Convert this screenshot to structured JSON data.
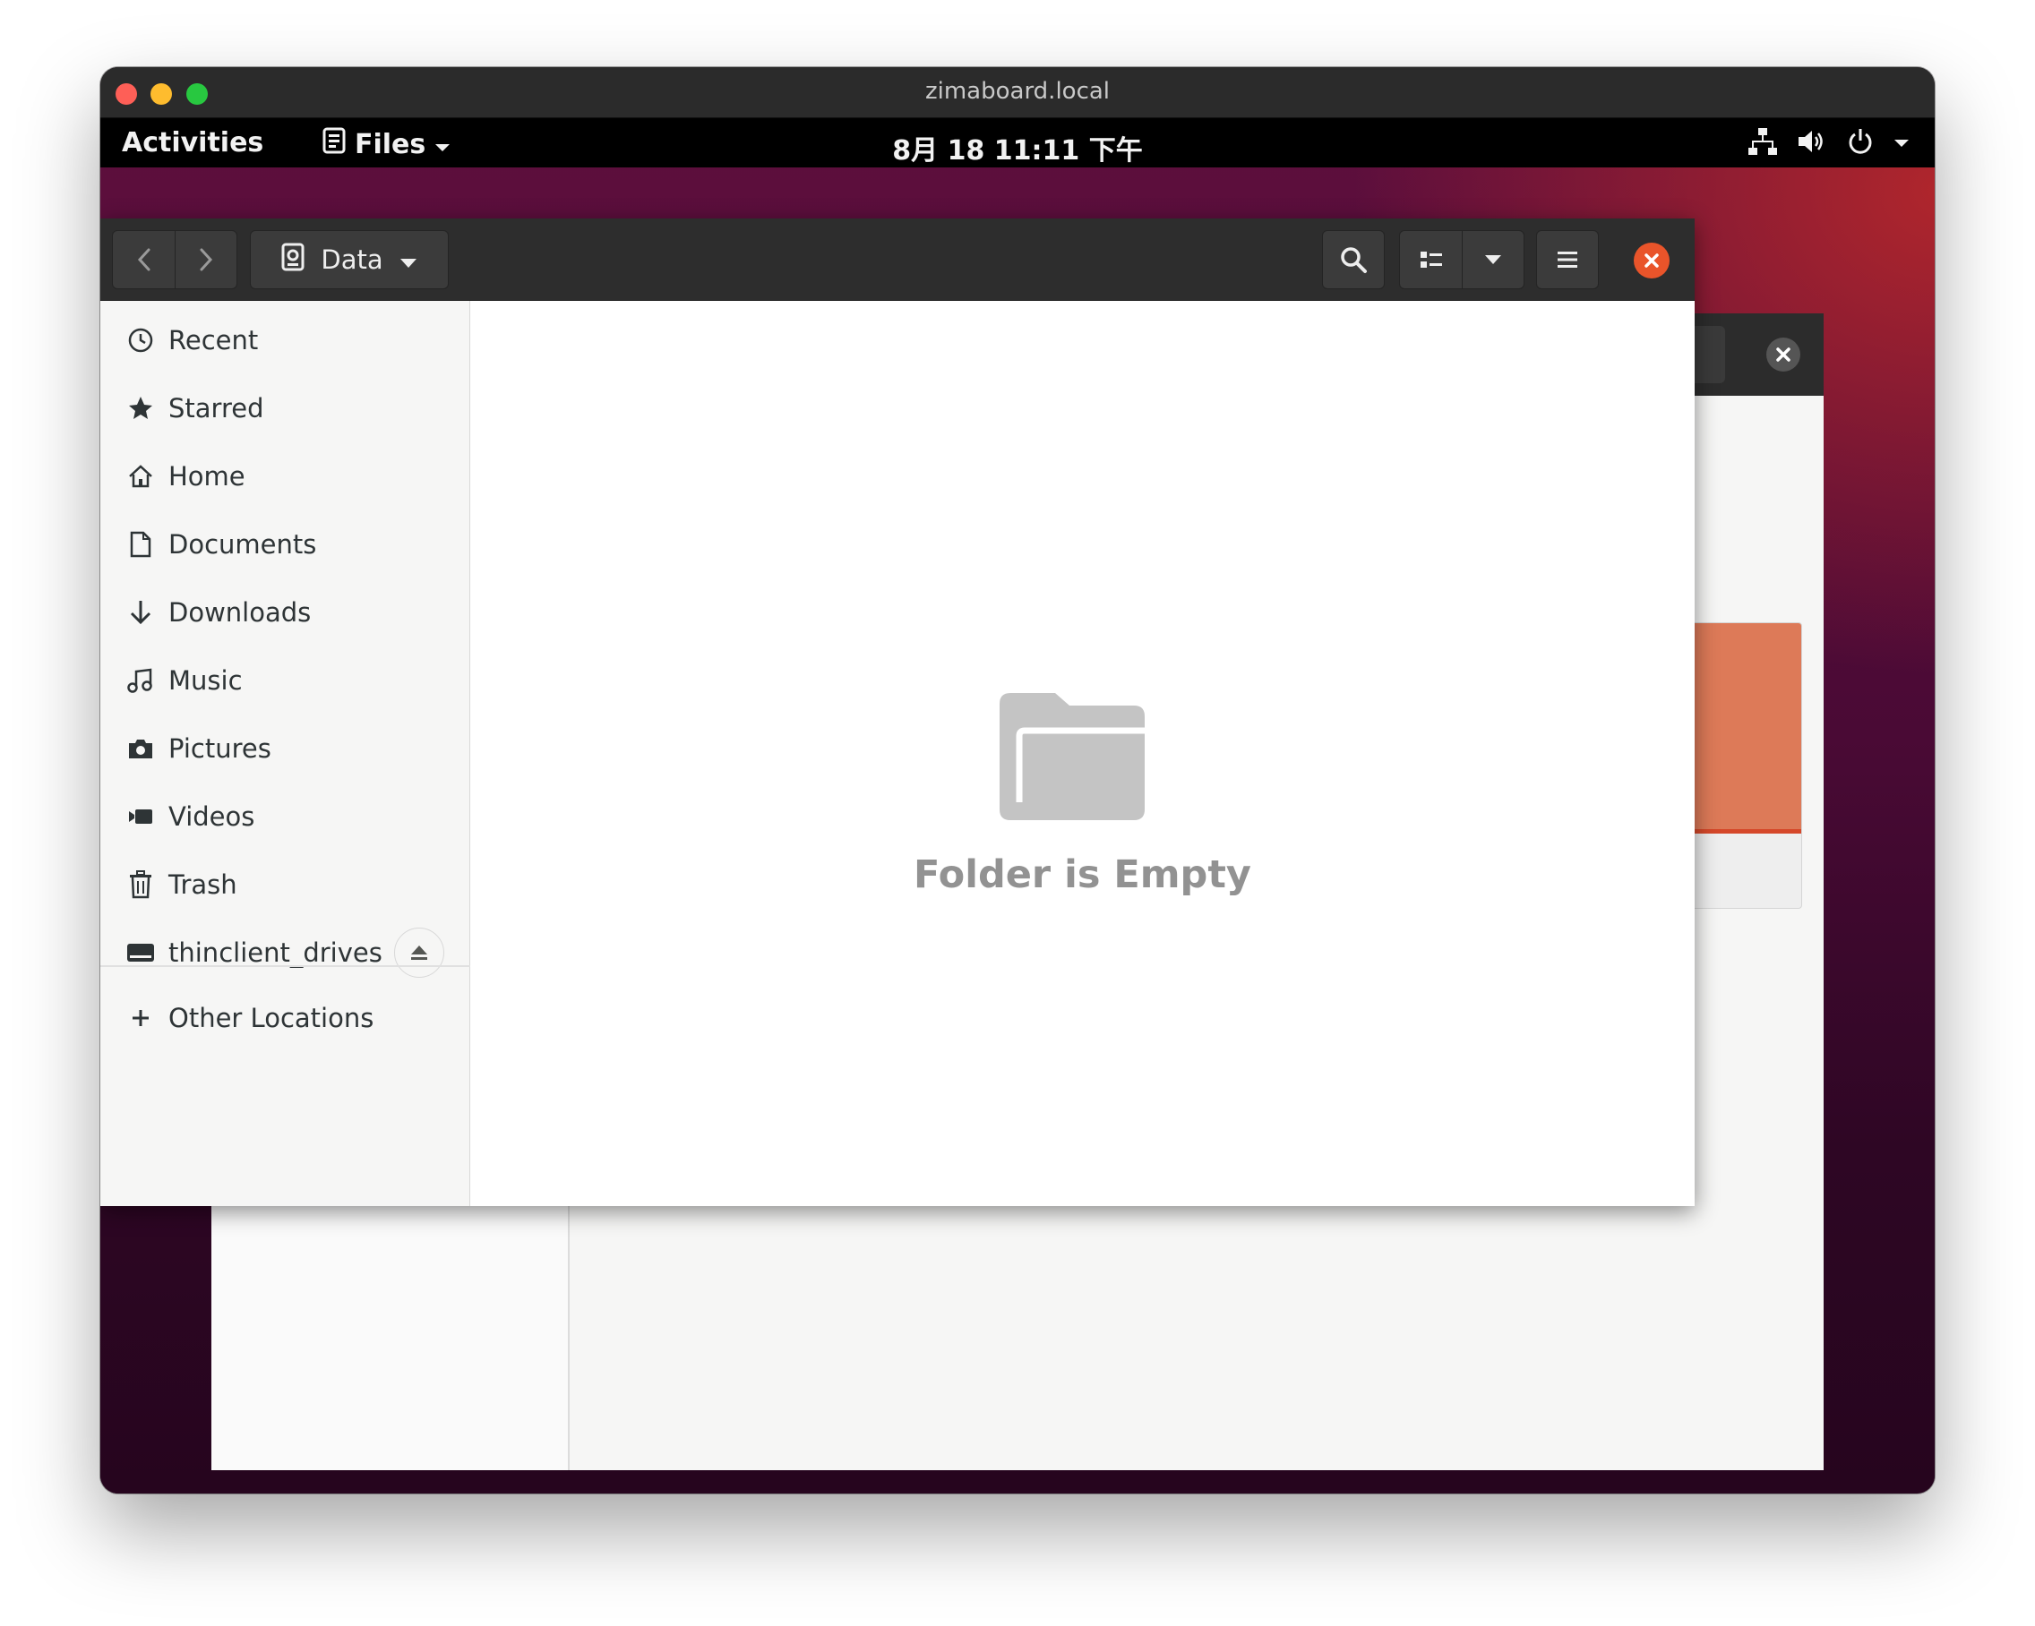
{
  "mac_window": {
    "title": "zimaboard.local"
  },
  "top_panel": {
    "activities_label": "Activities",
    "app_menu_label": "Files",
    "clock": "8月 18 11:11 下午"
  },
  "header": {
    "path_label": "Data"
  },
  "sidebar": {
    "items": [
      {
        "label": "Recent",
        "icon": "recent-icon"
      },
      {
        "label": "Starred",
        "icon": "star-icon"
      },
      {
        "label": "Home",
        "icon": "home-icon"
      },
      {
        "label": "Documents",
        "icon": "document-icon"
      },
      {
        "label": "Downloads",
        "icon": "download-icon"
      },
      {
        "label": "Music",
        "icon": "music-icon"
      },
      {
        "label": "Pictures",
        "icon": "camera-icon"
      },
      {
        "label": "Videos",
        "icon": "video-icon"
      },
      {
        "label": "Trash",
        "icon": "trash-icon"
      },
      {
        "label": "thinclient_drives",
        "icon": "drive-icon"
      }
    ],
    "other_locations_label": "Other Locations"
  },
  "content": {
    "empty_message": "Folder is Empty"
  },
  "colors": {
    "accent_close": "#e9542a",
    "panel_bg": "#000000",
    "header_bg": "#2d2d2d"
  }
}
